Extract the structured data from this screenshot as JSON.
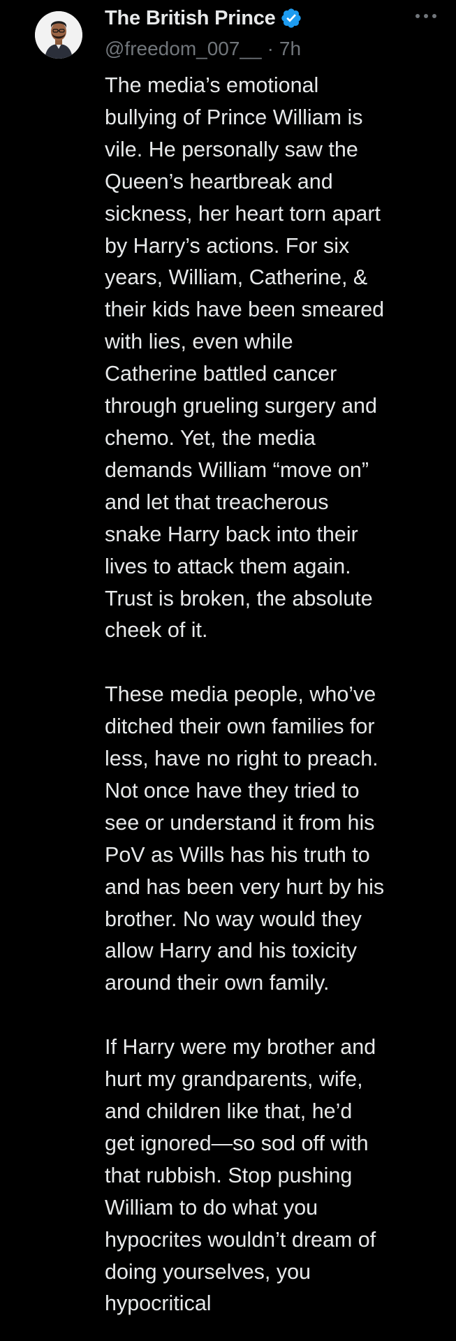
{
  "tweet": {
    "display_name": "The British Prince",
    "verified": true,
    "handle": "@freedom_007__",
    "separator": "·",
    "time": "7h",
    "more_icon": "more-horizontal-icon",
    "paragraphs": [
      [
        "The media’s emotional",
        "bullying of Prince William is",
        "vile. He personally saw the",
        "Queen’s heartbreak and",
        "sickness, her heart torn apart",
        "by Harry’s actions. For six",
        "years, William, Catherine, &",
        "their kids have been smeared",
        "with lies, even while",
        "Catherine battled cancer",
        "through grueling surgery and",
        "chemo. Yet, the media",
        "demands William “move on”",
        "and let that treacherous",
        "snake Harry back into their",
        "lives to attack them again.",
        "Trust is broken, the absolute",
        "cheek of it."
      ],
      [
        "These media people, who’ve",
        "ditched their own families for",
        "less, have no right to preach.",
        "Not once have they tried to",
        "see or understand it from his",
        "PoV as Wills has his truth to",
        "and has been very hurt by his",
        "brother. No way would they",
        "allow Harry and his toxicity",
        "around their own family."
      ],
      [
        "If Harry were my brother and",
        "hurt my grandparents, wife,",
        "and children like that, he’d",
        "get ignored—so sod off with",
        "that rubbish. Stop pushing",
        "William to do what you",
        "hypocrites wouldn’t dream of",
        "doing yourselves, you",
        "hypocritical"
      ]
    ]
  },
  "colors": {
    "background": "#000000",
    "text": "#e7e9ea",
    "secondary": "#71767b",
    "verified": "#1d9bf0"
  }
}
